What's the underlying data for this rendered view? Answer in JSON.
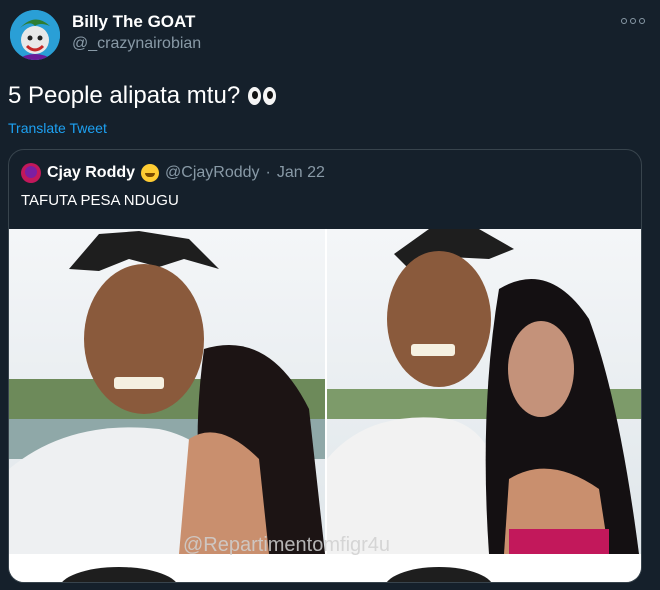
{
  "author": {
    "name": "Billy The GOAT",
    "handle": "@_crazynairobian"
  },
  "tweet": {
    "text": "5 People alipata mtu?",
    "emoji_icon": "eyes-emoji-icon",
    "translate_label": "Translate Tweet"
  },
  "quoted": {
    "name": "Cjay Roddy",
    "name_emoji_icon": "grinning-face-emoji-icon",
    "handle": "@CjayRoddy",
    "separator": "·",
    "date": "Jan 22",
    "text": "TAFUTA PESA NDUGU",
    "image": {
      "watermark": "@Repartimentomfigr4u",
      "description_icon": "photo-collage-two-panels"
    }
  },
  "colors": {
    "background": "#15202b",
    "text_primary": "#ffffff",
    "text_secondary": "#8899a6",
    "link": "#1da1f2",
    "border": "#38444d"
  }
}
